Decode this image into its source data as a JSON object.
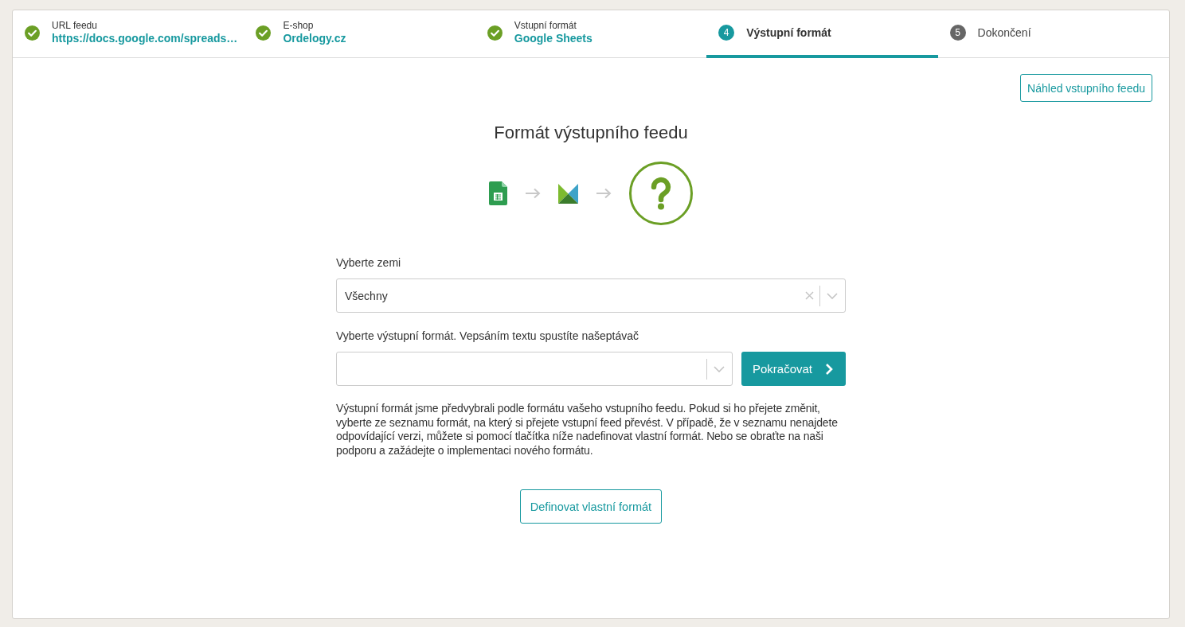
{
  "steps": [
    {
      "kind": "done",
      "label": "URL feedu",
      "value": "https://docs.google.com/spreads…",
      "selected": false
    },
    {
      "kind": "done",
      "label": "E-shop",
      "value": "Ordelogy.cz",
      "selected": false
    },
    {
      "kind": "done",
      "label": "Vstupní formát",
      "value": "Google Sheets",
      "selected": false
    },
    {
      "kind": "numbered",
      "number": "4",
      "label": "Výstupní formát",
      "selected": true
    },
    {
      "kind": "numbered",
      "number": "5",
      "label": "Dokončení",
      "selected": false
    }
  ],
  "preview_button": "Náhled vstupního feedu",
  "title": "Formát výstupního feedu",
  "fields": [
    {
      "label": "Vyberte zemi",
      "value": "Všechny",
      "clearable": true
    },
    {
      "label": "Vyberte výstupní formát. Vepsáním textu spustíte našeptávač",
      "clearable": false,
      "button": "Pokračovat"
    }
  ],
  "help_text": "Výstupní formát jsme předvybrali podle formátu vašeho vstupního feedu. Pokud si ho přejete změnit, vyberte ze seznamu formát, na který si přejete vstupní feed převést. V případě, že v seznamu nenajdete odpovídající verzi, můžete si pomocí tlačítka níže nadefinovat vlastní formát. Nebo se obraťte na naši podporu a zažádejte o implementaci nového formátu.",
  "define_button": "Definovat vlastní formát"
}
